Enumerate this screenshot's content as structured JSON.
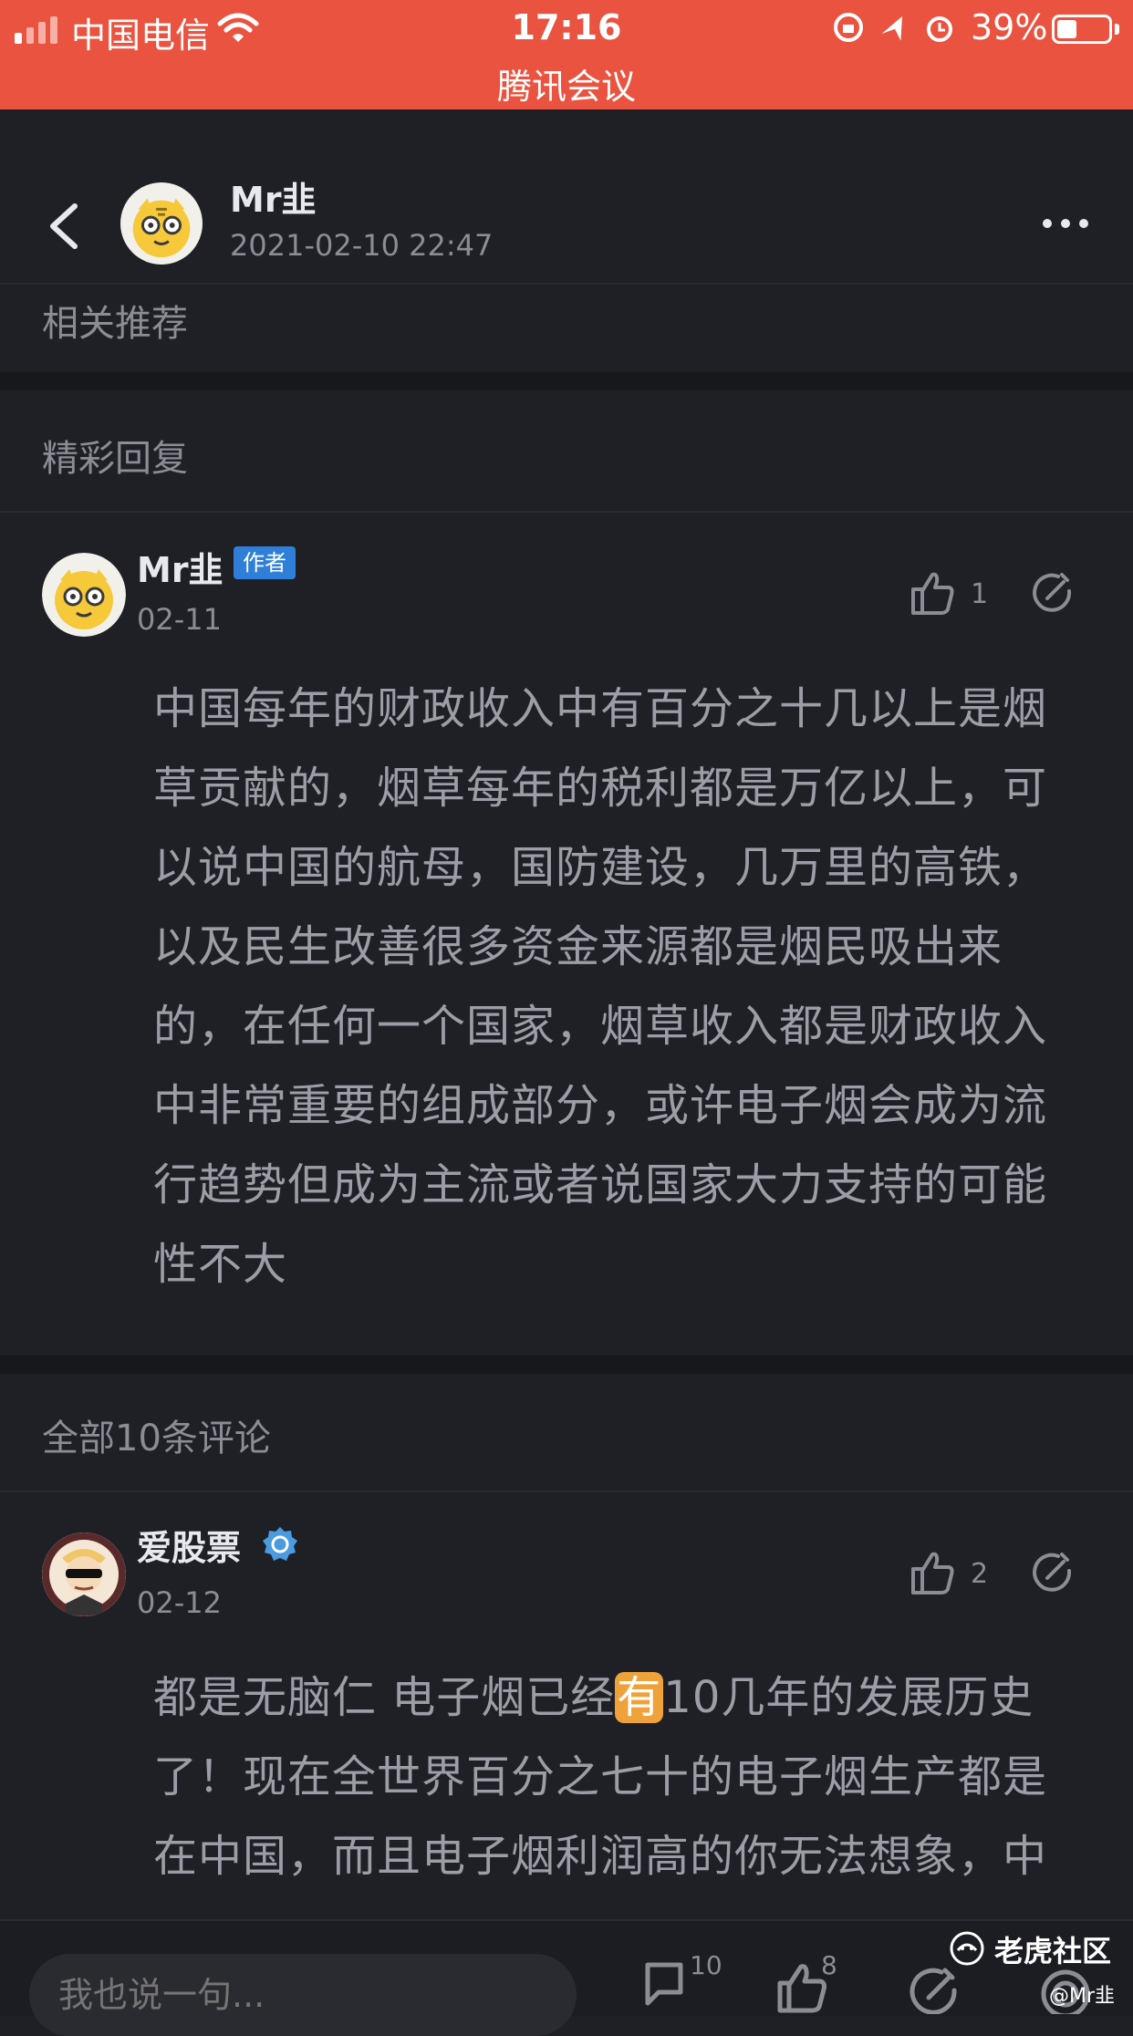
{
  "status_bar": {
    "carrier": "中国电信",
    "time": "17:16",
    "battery": "39%",
    "battery_level": 0.39,
    "app_banner": "腾讯会议",
    "bg_color": "#e9533f"
  },
  "header": {
    "author": "Mr韭",
    "timestamp": "2021-02-10 22:47"
  },
  "sections": {
    "related": "相关推荐",
    "featured": "精彩回复",
    "all_comments": "全部10条评论"
  },
  "featured_reply": {
    "user": "Mr韭",
    "badge": "作者",
    "date": "02-11",
    "likes": "1",
    "lines": [
      "中国每年的财政收入中有百分之十几以上是烟",
      "草贡献的，烟草每年的税利都是万亿以上，可",
      "以说中国的航母，国防建设，几万里的高铁，",
      "以及民生改善很多资金来源都是烟民吸出来",
      "的，在任何一个国家，烟草收入都是财政收入",
      "中非常重要的组成部分，或许电子烟会成为流",
      "行趋势但成为主流或者说国家大力支持的可能",
      "性不大"
    ]
  },
  "comment_1": {
    "user": "爱股票",
    "date": "02-12",
    "likes": "2",
    "line1_a": "都是无脑仁 电子烟已经",
    "line1_hl": "有",
    "line1_b": "10几年的发展历史",
    "line2": "了！现在全世界百分之七十的电子烟生产都是",
    "line3": "在中国，而且电子烟利润高的你无法想象，中"
  },
  "bottom_bar": {
    "input_placeholder": "我也说一句...",
    "comment_count": "10",
    "like_count": "8"
  },
  "watermark": {
    "text": "老虎社区",
    "user": "@Mr韭"
  }
}
